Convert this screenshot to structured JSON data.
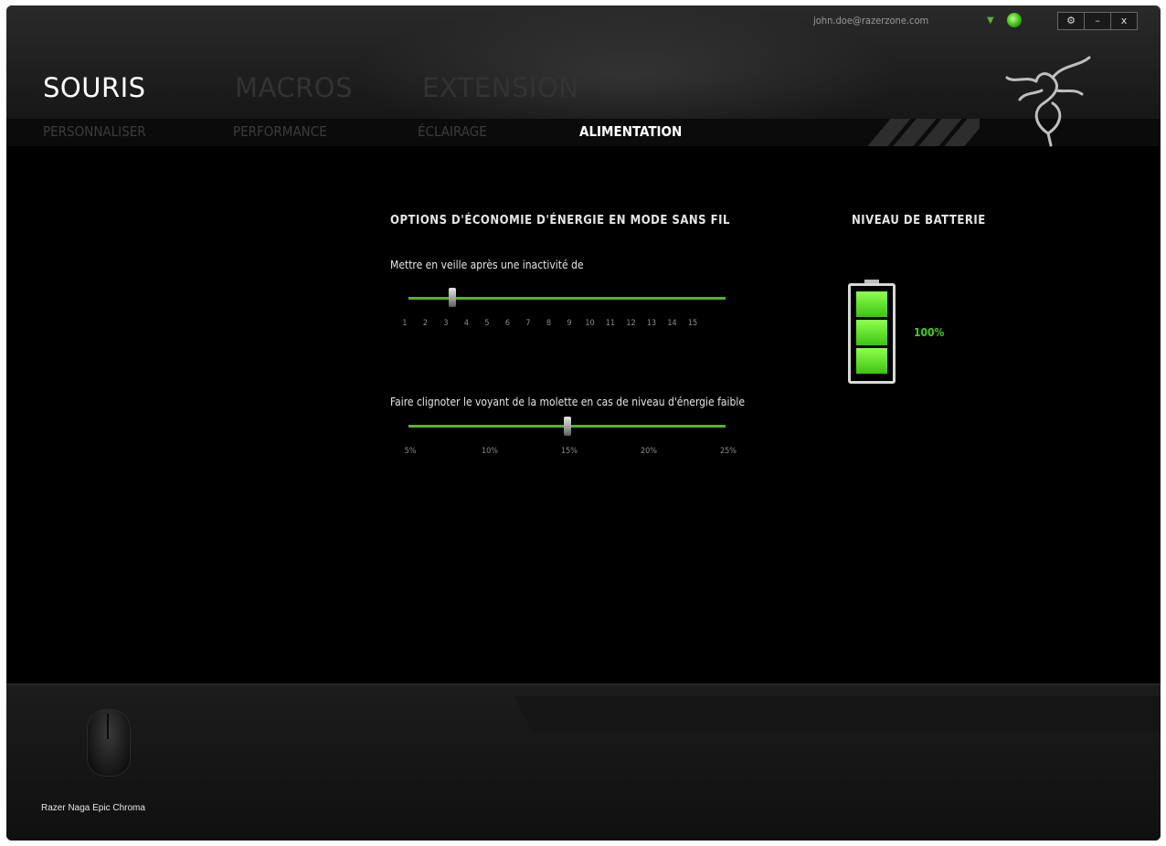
{
  "account": {
    "email": "john.doe@razerzone.com"
  },
  "window_controls": [
    "⚙",
    "–",
    "x"
  ],
  "main_tabs": [
    {
      "label": "SOURIS",
      "active": true
    },
    {
      "label": "MACROS",
      "active": false
    },
    {
      "label": "EXTENSION",
      "active": false
    }
  ],
  "sub_tabs": [
    {
      "label": "PERSONNALISER",
      "active": false
    },
    {
      "label": "PERFORMANCE",
      "active": false
    },
    {
      "label": "ÉCLAIRAGE",
      "active": false
    },
    {
      "label": "ALIMENTATION",
      "active": true
    }
  ],
  "power": {
    "title": "OPTIONS D'ÉCONOMIE D'ÉNERGIE EN MODE SANS FIL",
    "sleep": {
      "label": "Mettre en veille après une inactivité de",
      "ticks": [
        "1",
        "2",
        "3",
        "4",
        "5",
        "6",
        "7",
        "8",
        "9",
        "10",
        "11",
        "12",
        "13",
        "14",
        "15"
      ],
      "value": 3
    },
    "blink": {
      "label": "Faire clignoter le voyant de la molette en cas de niveau d'énergie faible",
      "ticks": [
        "5%",
        "10%",
        "15%",
        "20%",
        "25%"
      ],
      "value": "15%"
    }
  },
  "battery": {
    "title": "NIVEAU DE BATTERIE",
    "percent_text": "100%",
    "level": 1.0
  },
  "device": {
    "name": "Razer Naga Epic Chroma"
  },
  "colors": {
    "accent": "#44d11a",
    "track": "#58b12b",
    "background": "#000000"
  }
}
